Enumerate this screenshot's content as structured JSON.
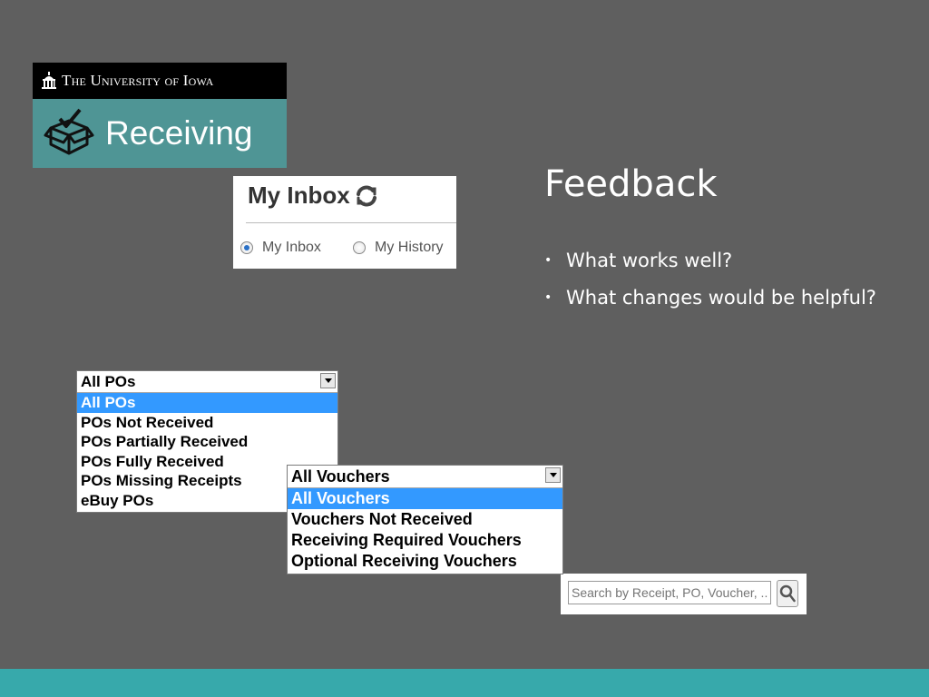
{
  "logo": {
    "university": "The University of Iowa",
    "university_lead": "T",
    "university_small": "he ",
    "u_cap": "U",
    "u_rest": "niversity of ",
    "i_cap": "I",
    "i_rest": "owa",
    "app_name": "Receiving",
    "bar_color": "#000000",
    "accent_color": "#4f9595",
    "icon": "box-check-icon"
  },
  "inbox": {
    "title": "My Inbox",
    "refresh_icon": "refresh-icon",
    "options": [
      {
        "label": "My Inbox",
        "selected": true
      },
      {
        "label": "My History",
        "selected": false
      }
    ]
  },
  "feedback": {
    "title": "Feedback",
    "bullets": [
      "What works well?",
      "What changes would be helpful?"
    ]
  },
  "po_filter": {
    "selected": "All POs",
    "options": [
      "All POs",
      "POs Not Received",
      "POs Partially Received",
      "POs Fully Received",
      "POs Missing Receipts",
      "eBuy POs"
    ],
    "highlight_color": "#3399ff"
  },
  "voucher_filter": {
    "selected": "All Vouchers",
    "options": [
      "All Vouchers",
      "Vouchers Not Received",
      "Receiving Required Vouchers",
      "Optional Receiving Vouchers"
    ]
  },
  "search": {
    "placeholder": "Search by Receipt, PO, Voucher, ...",
    "button_icon": "search-icon"
  },
  "theme": {
    "background": "#5f5f5f",
    "footer_color": "#37a9ab"
  }
}
